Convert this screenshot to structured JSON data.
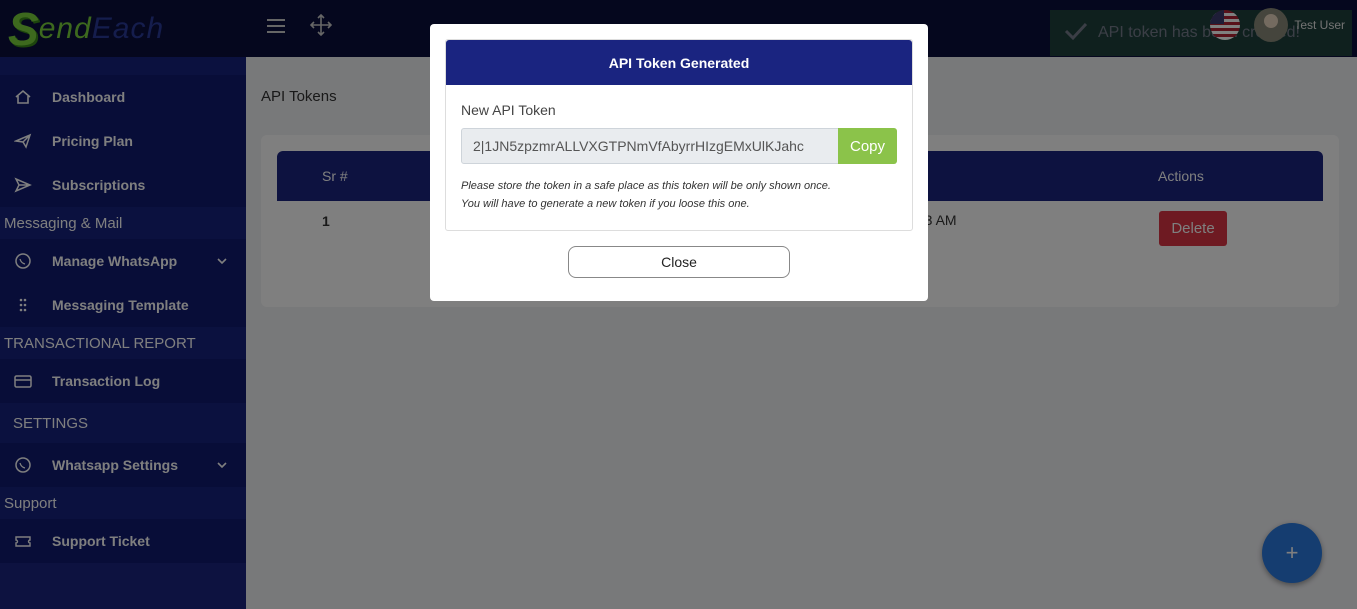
{
  "brand": {
    "logo_s": "S",
    "logo_end": "end",
    "logo_each": "Each"
  },
  "sidebar": {
    "items": [
      {
        "label": "Dashboard",
        "icon": "home-icon"
      },
      {
        "label": "Pricing Plan",
        "icon": "send-icon"
      },
      {
        "label": "Subscriptions",
        "icon": "paper-plane-icon"
      }
    ],
    "section_messaging": "Messaging & Mail",
    "manage_whatsapp": "Manage WhatsApp",
    "messaging_template": "Messaging Template",
    "section_report": "TRANSACTIONAL REPORT",
    "transaction_log": "Transaction Log",
    "section_settings": "SETTINGS",
    "whatsapp_settings": "Whatsapp Settings",
    "section_support": "Support",
    "support_ticket": "Support Ticket"
  },
  "topbar": {
    "toast_text": "API token has been created!",
    "user_name": "Test User"
  },
  "page": {
    "title": "API Tokens",
    "table": {
      "headers": [
        "Sr #",
        "Actions"
      ],
      "rows": [
        {
          "sr": "1",
          "time": ":53 AM",
          "action": "Delete"
        }
      ]
    },
    "fab_label": "+"
  },
  "modal": {
    "title": "API Token Generated",
    "label": "New API Token",
    "token": "2|1JN5zpzmrALLVXGTPNmVfAbyrrHIzgEMxUlKJahc",
    "copy_label": "Copy",
    "note_line1": "Please store the token in a safe place as this token will be only shown once.",
    "note_line2": "You will have to generate a new token if you loose this one.",
    "close_label": "Close"
  },
  "colors": {
    "sidebar": "#1a2480",
    "topbar": "#0a0f3d",
    "copy": "#8bc34a",
    "delete": "#dc3545",
    "fab": "#2a7ae0"
  }
}
